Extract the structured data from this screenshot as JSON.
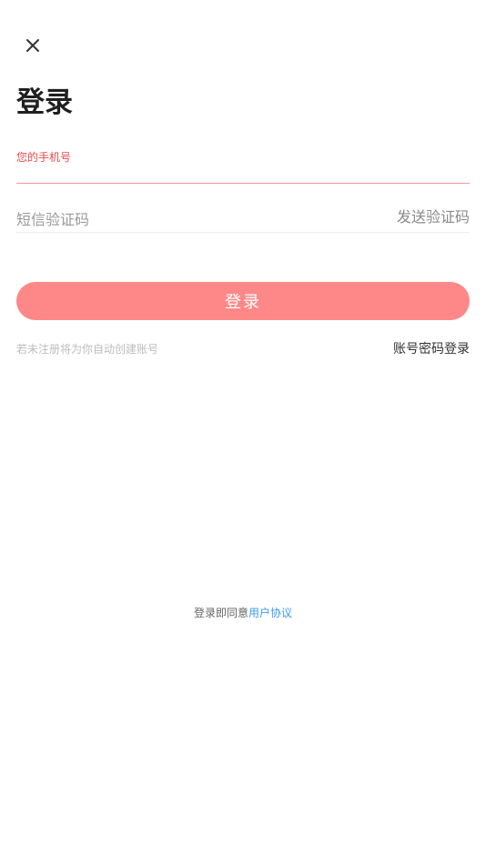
{
  "header": {
    "close_icon": "close-icon",
    "title": "登录"
  },
  "form": {
    "phone_label": "您的手机号",
    "phone_value": "",
    "code_placeholder": "短信验证码",
    "send_code_label": "发送验证码"
  },
  "login_button": {
    "label": "登录",
    "color": "#fe8888"
  },
  "hint": "若未注册将为你自动创建账号",
  "password_login_label": "账号密码登录",
  "footer": {
    "agreement_prefix": "登录即同意",
    "agreement_link": "用户协议",
    "link_color": "#3b9bf3"
  },
  "colors": {
    "accent": "#e84a4a",
    "primary_button": "#fe8888"
  }
}
